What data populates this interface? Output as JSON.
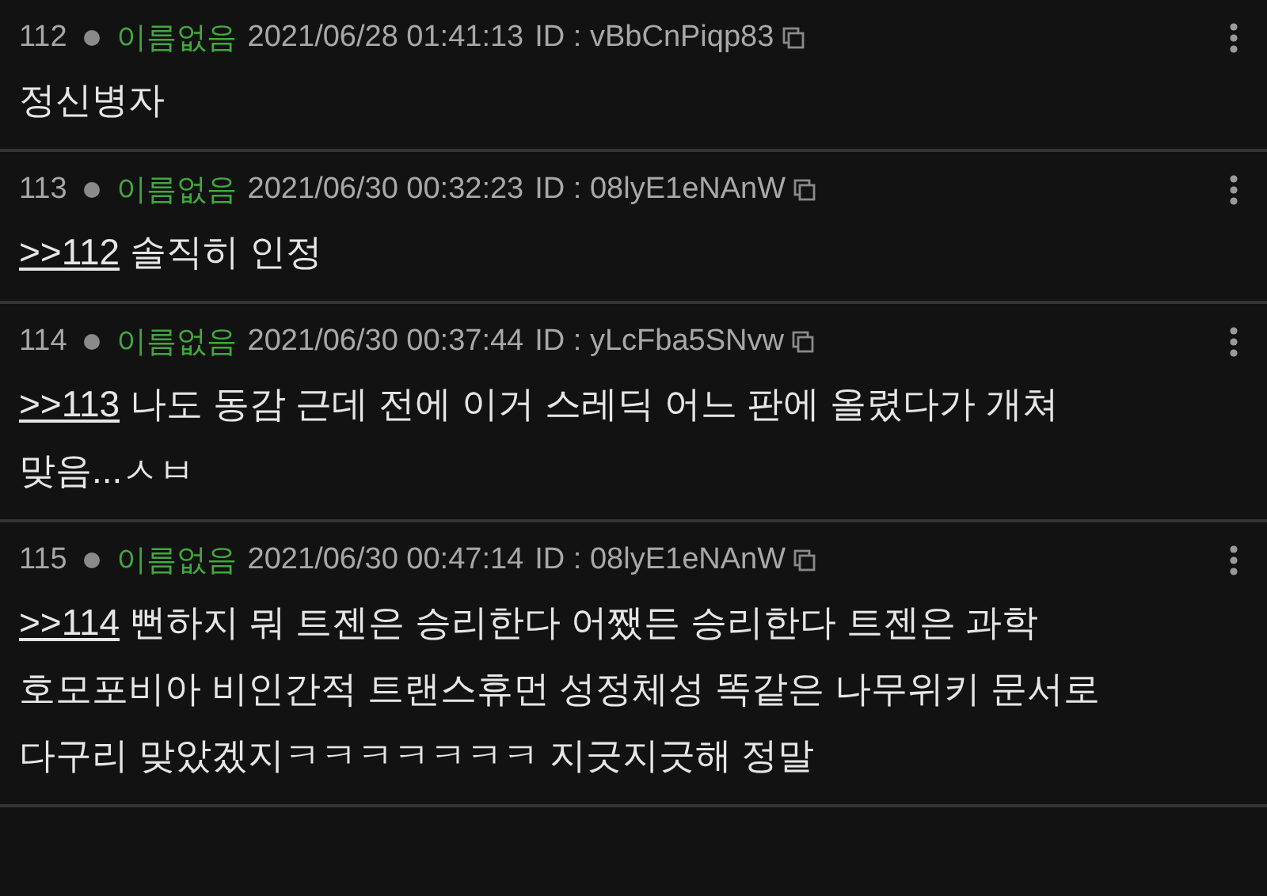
{
  "posts": [
    {
      "number": "112",
      "name": "이름없음",
      "datetime": "2021/06/28 01:41:13",
      "id": "ID : vBbCnPiqp83",
      "body": "정신병자"
    },
    {
      "number": "113",
      "name": "이름없음",
      "datetime": "2021/06/30 00:32:23",
      "id": "ID : 08lyE1eNAnW",
      "reply": ">>112",
      "body": "솔직히 인정"
    },
    {
      "number": "114",
      "name": "이름없음",
      "datetime": "2021/06/30 00:37:44",
      "id": "ID : yLcFba5SNvw",
      "reply": ">>113",
      "body": "나도 동감 근데 전에 이거 스레딕 어느 판에 올렸다가 개쳐 맞음...ㅅㅂ"
    },
    {
      "number": "115",
      "name": "이름없음",
      "datetime": "2021/06/30 00:47:14",
      "id": "ID : 08lyE1eNAnW",
      "reply": ">>114",
      "body": "뻔하지 뭐 트젠은 승리한다 어쨌든 승리한다 트젠은 과학 호모포비아 비인간적 트랜스휴먼 성정체성 똑같은 나무위키 문서로 다구리 맞았겠지ㅋㅋㅋㅋㅋㅋㅋ 지긋지긋해 정말"
    }
  ]
}
